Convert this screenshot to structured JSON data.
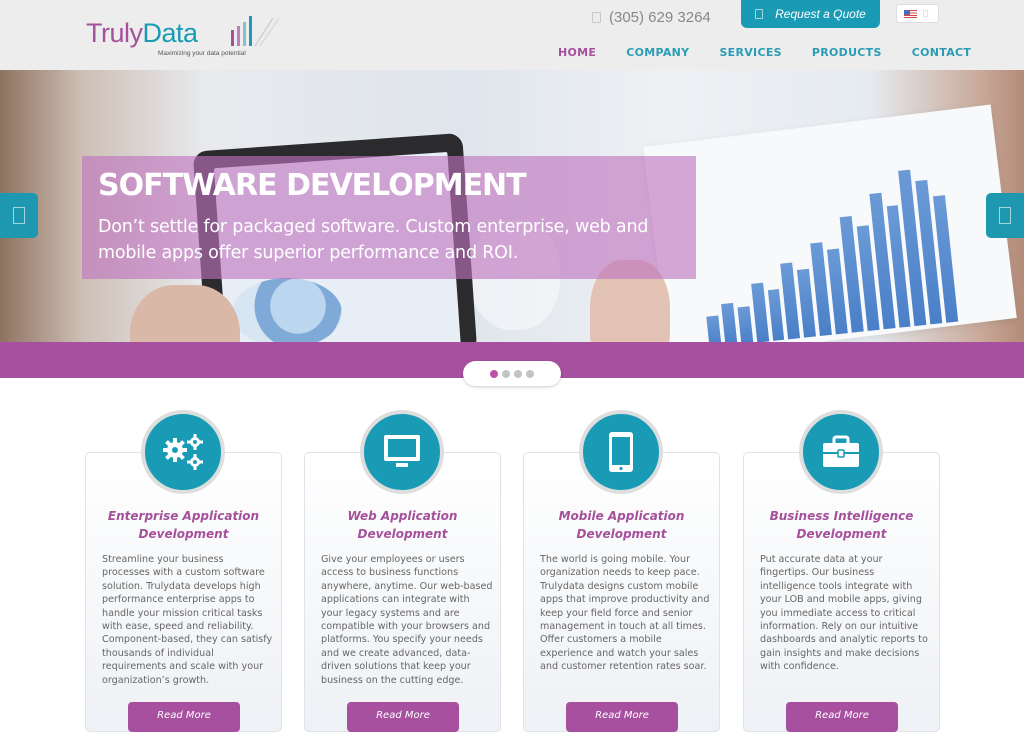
{
  "header": {
    "logo": {
      "word1": "Truly",
      "word2": "Data",
      "tagline": "Maximizing your data potential"
    },
    "phone": "(305) 629 3264",
    "quote_button": "Request a Quote",
    "language": "en-US",
    "nav": [
      {
        "label": "HOME",
        "active": true
      },
      {
        "label": "COMPANY",
        "active": false
      },
      {
        "label": "SERVICES",
        "active": false
      },
      {
        "label": "PRODUCTS",
        "active": false
      },
      {
        "label": "CONTACT",
        "active": false
      }
    ]
  },
  "hero": {
    "title": "SOFTWARE DEVELOPMENT",
    "subtitle": "Don’t settle for packaged software. Custom enterprise, web and mobile apps offer superior performance and ROI.",
    "slides_total": 4,
    "active_slide": 1
  },
  "colors": {
    "brand_purple": "#a6509f",
    "brand_teal": "#1a9bb5",
    "header_bg": "#ededed"
  },
  "services": [
    {
      "icon": "gears-icon",
      "title": "Enterprise Application Development",
      "text": "Streamline your business processes with a custom software solution. Trulydata develops high performance enterprise apps to handle your mission critical tasks with ease, speed and reliability. Component-based, they can satisfy thousands of individual requirements and scale with your organization’s growth.",
      "button": "Read More"
    },
    {
      "icon": "desktop-monitor-icon",
      "title": "Web Application Development",
      "text": "Give your employees or users access to business functions anywhere, anytime. Our web-based applications can integrate with your legacy systems and are compatible with your browsers and platforms. You specify your needs and we create advanced, data-driven solutions that keep your business on the cutting edge.",
      "button": "Read More"
    },
    {
      "icon": "mobile-phone-icon",
      "title": "Mobile Application Development",
      "text": "The world is going mobile. Your organization needs to keep pace. Trulydata designs custom mobile apps that improve productivity and keep your field force and senior management in touch at all times. Offer customers a mobile experience and watch your sales and customer retention rates soar.",
      "button": "Read More"
    },
    {
      "icon": "briefcase-icon",
      "title": "Business Intelligence Development",
      "text": "Put accurate data at your fingertips. Our business intelligence tools integrate with your LOB and mobile apps, giving you immediate access to critical information. Rely on our intuitive dashboards and analytic reports to gain insights and make decisions with confidence.",
      "button": "Read More"
    }
  ]
}
